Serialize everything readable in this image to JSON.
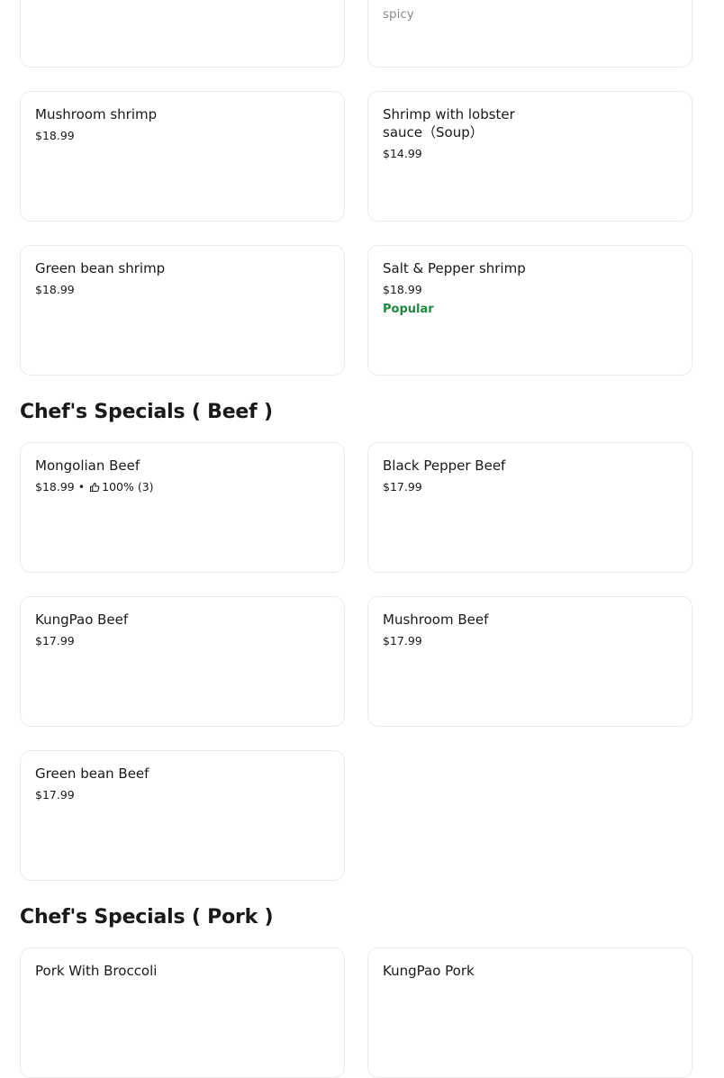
{
  "cards_top": {
    "left": {
      "name": "",
      "price": ""
    },
    "right": {
      "desc": "spicy"
    }
  },
  "shrimp": {
    "items": [
      {
        "name": "Mushroom shrimp",
        "price": "$18.99"
      },
      {
        "name": "Shrimp with lobster sauce（Soup）",
        "price": "$14.99"
      },
      {
        "name": "Green bean shrimp",
        "price": "$18.99"
      },
      {
        "name": "Salt & Pepper shrimp",
        "price": "$18.99",
        "badge": "Popular"
      }
    ]
  },
  "beef": {
    "title": "Chef's Specials ( Beef )",
    "items": [
      {
        "name": "Mongolian Beef",
        "price": "$18.99",
        "separator": "•",
        "rating": "100% (3)",
        "icon": "thumbs-up-icon"
      },
      {
        "name": "Black Pepper Beef",
        "price": "$17.99"
      },
      {
        "name": "KungPao Beef",
        "price": "$17.99"
      },
      {
        "name": "Mushroom Beef",
        "price": "$17.99"
      },
      {
        "name": "Green bean Beef",
        "price": "$17.99"
      }
    ]
  },
  "pork": {
    "title": "Chef's Specials ( Pork )",
    "items": [
      {
        "name": "Pork With Broccoli"
      },
      {
        "name": "KungPao Pork"
      }
    ]
  },
  "colors": {
    "badge": "#1e8a3e",
    "border": "#ebebeb",
    "text": "#191919",
    "muted": "#8a8a8a"
  }
}
